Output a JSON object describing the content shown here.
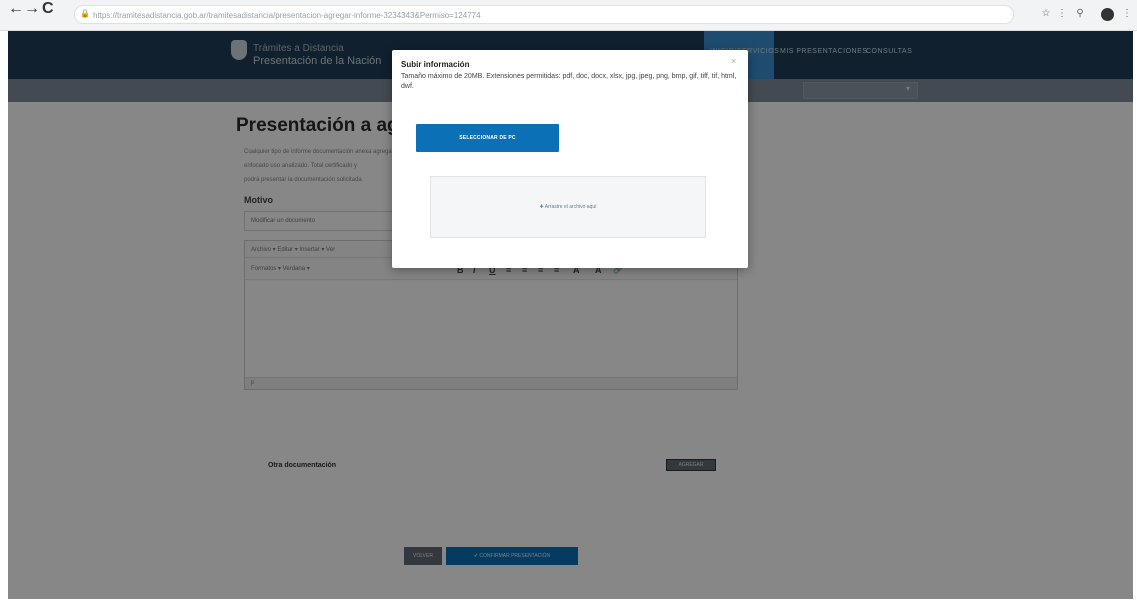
{
  "browser": {
    "url": "https://tramitesadistancia.gob.ar/tramitesadistancia/presentacion-agregar-informe-3234343&Permiso=124774",
    "nav_back": "←",
    "nav_forward": "→",
    "nav_reload": "C",
    "lock": "🔒",
    "ext_icons": [
      "☆",
      "⋮",
      "⚲",
      "⋮"
    ]
  },
  "header": {
    "logo_line1": "Trámites a Distancia",
    "logo_line2": "Presentación de la Nación",
    "nav_links": [
      "INICIO/SERVICIOS",
      "MIS PRESENTACIONES",
      "CONSULTAS"
    ]
  },
  "main": {
    "title": "Presentación a ag",
    "paragraph_lines": [
      "Cualquier tipo de informe documentación anexa agregar aquí",
      "enfocado uso analizado. Total certificado y",
      "podrá presentar la documentación solicitada"
    ],
    "motivo_label": "Motivo",
    "motivo_value": "Modificar un documento",
    "editor_menu": "Archivo ▾   Editar ▾   Insertar ▾   Ver",
    "editor_toolbar": "Formatos ▾   Verdana     ▾",
    "editor_icons": [
      "B",
      "I",
      "U",
      "≡",
      "≡",
      "≡",
      "≡",
      "A",
      "A",
      "🔗"
    ],
    "editor_status": "p",
    "otra_label": "Otra documentación",
    "agregar_label": "AGREGAR",
    "volver_label": "VOLVER",
    "confirmar_label": "✔ CONFIRMAR PRESENTACIÓN"
  },
  "modal": {
    "title": "Subir información",
    "description": "Tamaño máximo de 20MB. Extensiones permitidas: pdf, doc, docx, xlsx, jpg, jpeg, png, bmp, gif, tiff, tif, html, dwf.",
    "close": "×",
    "upload_button": "SELECCIONAR DE PC",
    "dropzone_text": "✚ Arrastre el archivo aquí"
  }
}
